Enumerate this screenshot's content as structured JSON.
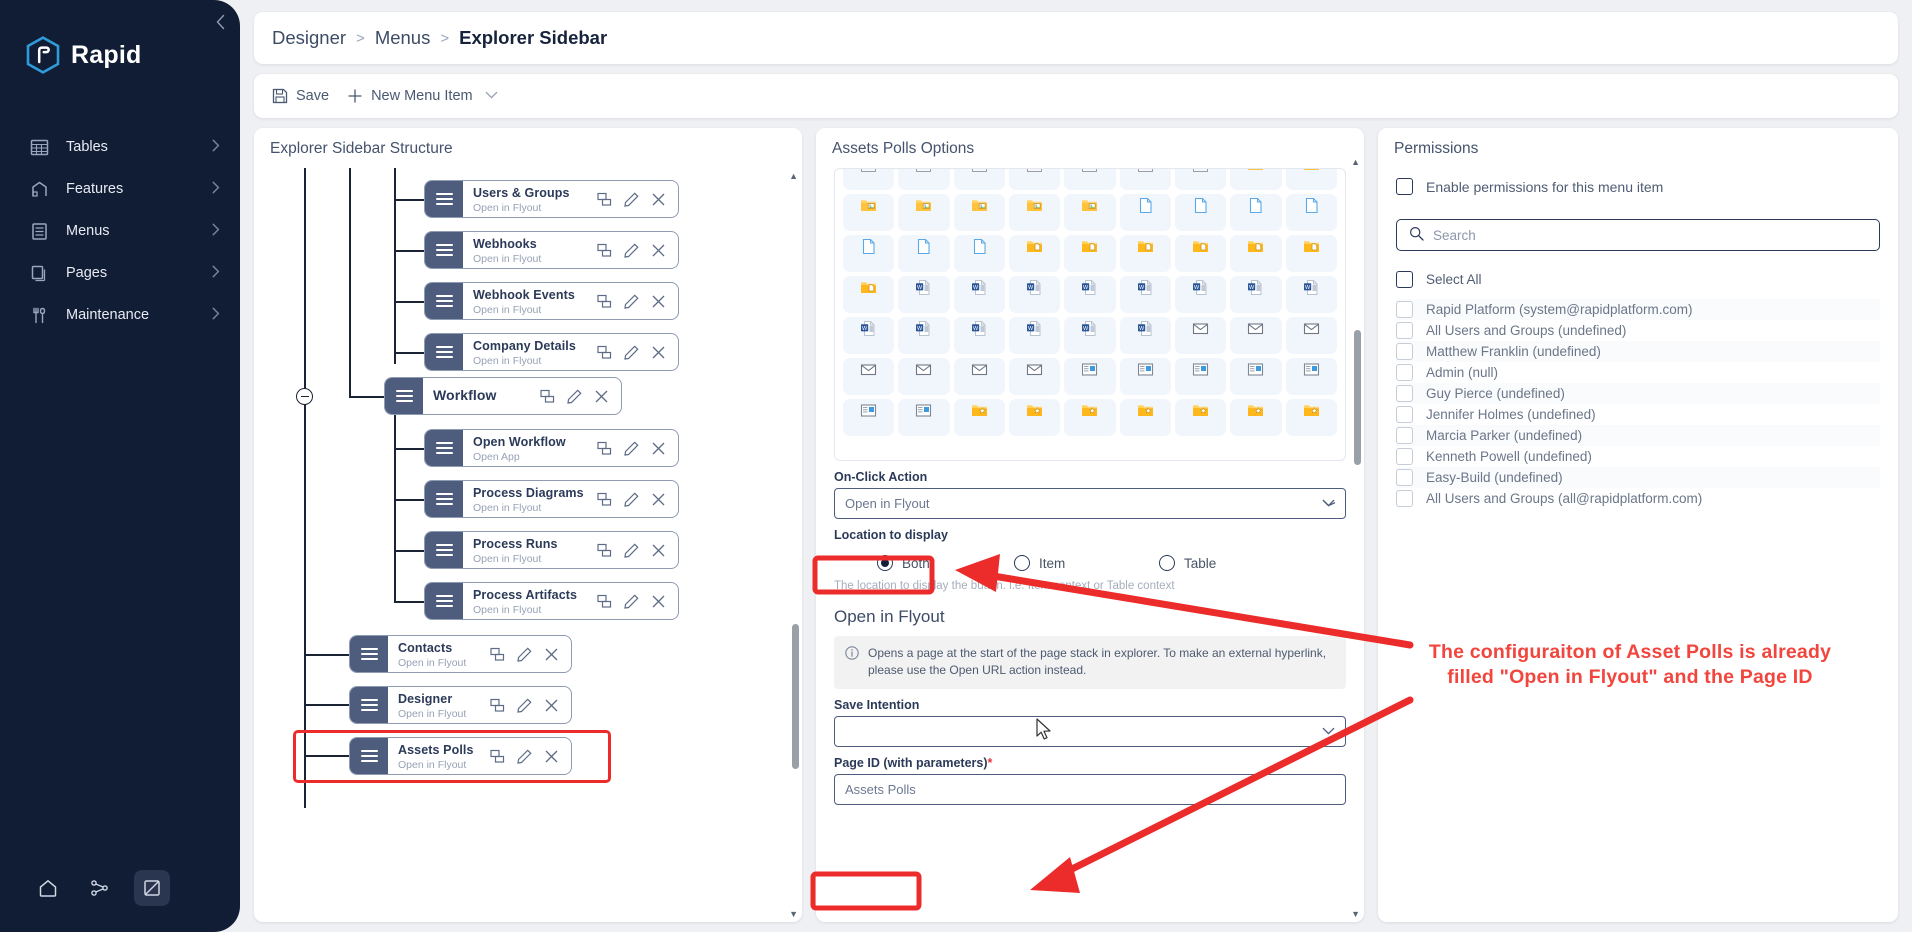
{
  "sidebar": {
    "brand": "Rapid",
    "collapse_icon": "chevron-left-icon",
    "items": [
      {
        "label": "Tables",
        "icon": "table-icon"
      },
      {
        "label": "Features",
        "icon": "features-icon"
      },
      {
        "label": "Menus",
        "icon": "menu-list-icon"
      },
      {
        "label": "Pages",
        "icon": "pages-icon"
      },
      {
        "label": "Maintenance",
        "icon": "maintenance-icon"
      }
    ],
    "footer": [
      {
        "name": "home-icon"
      },
      {
        "name": "sitemap-icon"
      },
      {
        "name": "chart-off-icon"
      }
    ]
  },
  "breadcrumb": {
    "root": "Designer",
    "middle": "Menus",
    "current": "Explorer Sidebar",
    "separator": ">"
  },
  "toolbar": {
    "save_label": "Save",
    "new_item_label": "New Menu Item",
    "chevron": "⌄"
  },
  "tree_panel": {
    "title": "Explorer Sidebar Structure",
    "nodes": [
      {
        "title": "Users & Groups",
        "sub": "Open in Flyout",
        "depth": 3
      },
      {
        "title": "Webhooks",
        "sub": "Open in Flyout",
        "depth": 3
      },
      {
        "title": "Webhook Events",
        "sub": "Open in Flyout",
        "depth": 3
      },
      {
        "title": "Company Details",
        "sub": "Open in Flyout",
        "depth": 3
      },
      {
        "title": "Workflow",
        "sub": "",
        "depth": 2
      },
      {
        "title": "Open Workflow",
        "sub": "Open App",
        "depth": 3
      },
      {
        "title": "Process Diagrams",
        "sub": "Open in Flyout",
        "depth": 3
      },
      {
        "title": "Process Runs",
        "sub": "Open in Flyout",
        "depth": 3
      },
      {
        "title": "Process Artifacts",
        "sub": "Open in Flyout",
        "depth": 3
      },
      {
        "title": "Contacts",
        "sub": "Open in Flyout",
        "depth": 1
      },
      {
        "title": "Designer",
        "sub": "Open in Flyout",
        "depth": 1
      },
      {
        "title": "Assets Polls",
        "sub": "Open in Flyout",
        "depth": 1
      }
    ],
    "actions": [
      "copy-icon",
      "edit-pencil-icon",
      "close-x-icon"
    ]
  },
  "options_panel": {
    "title": "Assets Polls Options",
    "onclick_label": "On-Click Action",
    "onclick_value": "Open in Flyout",
    "location_label": "Location to display",
    "location_options": [
      {
        "label": "Both",
        "selected": true
      },
      {
        "label": "Item",
        "selected": false
      },
      {
        "label": "Table",
        "selected": false
      }
    ],
    "location_helper": "The location to display the button. i.e. Item context or Table context",
    "section_title": "Open in Flyout",
    "info_text": "Opens a page at the start of the page stack in explorer. To make an external hyperlink, please use the Open URL action instead.",
    "save_intention_label": "Save Intention",
    "save_intention_value": "",
    "page_id_label": "Page ID (with parameters)",
    "page_id_required": "*",
    "page_id_value": "Assets Polls",
    "icon_grid": [
      "image-purple",
      "image-purple",
      "image-purple",
      "image-purple",
      "image-purple",
      "image-purple",
      "image-purple",
      "folder-img",
      "folder-img",
      "folder-img",
      "folder-img",
      "folder-img",
      "folder-img",
      "folder-img",
      "file-blue",
      "file-blue",
      "file-blue",
      "file-blue",
      "file-blue",
      "file-blue",
      "file-blue",
      "folder-doc",
      "folder-doc",
      "folder-doc",
      "folder-doc",
      "folder-doc",
      "folder-doc",
      "folder-doc",
      "word-doc",
      "word-doc",
      "word-doc",
      "word-doc",
      "word-doc",
      "word-doc",
      "word-doc",
      "word-doc",
      "word-doc",
      "word-doc",
      "word-doc",
      "word-doc",
      "word-doc",
      "word-doc",
      "mail",
      "mail",
      "mail",
      "mail",
      "mail",
      "mail",
      "mail",
      "card-blue",
      "card-blue",
      "card-blue",
      "card-blue",
      "card-blue",
      "card-blue",
      "card-blue",
      "folder-star",
      "folder-star",
      "folder-star",
      "folder-star",
      "folder-star",
      "folder-star",
      "folder-star"
    ]
  },
  "permissions_panel": {
    "title": "Permissions",
    "enable_label": "Enable permissions for this menu item",
    "enable_checked": false,
    "search_placeholder": "Search",
    "search_icon": "search-icon",
    "select_all_label": "Select All",
    "items": [
      "Rapid Platform (system@rapidplatform.com)",
      "All Users and Groups (undefined)",
      "Matthew Franklin (undefined)",
      "Admin (null)",
      "Guy Pierce (undefined)",
      "Jennifer Holmes (undefined)",
      "Marcia Parker (undefined)",
      "Kenneth Powell (undefined)",
      "Easy-Build (undefined)",
      "All Users and Groups (all@rapidplatform.com)"
    ]
  },
  "annotation": {
    "text": "The configuraiton of Asset Polls is already filled \"Open in Flyout\" and the Page ID",
    "color": "#f2453d"
  }
}
